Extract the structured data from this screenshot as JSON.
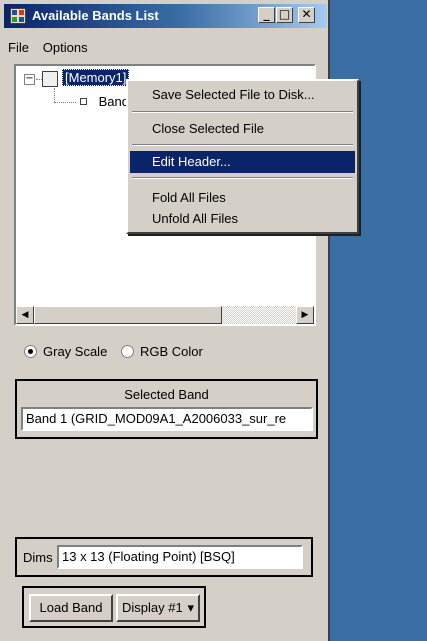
{
  "window": {
    "title": "Available Bands List",
    "controls": {
      "minimize": "_",
      "maximize": "□",
      "close": "✕"
    }
  },
  "menubar": {
    "file": "File",
    "options": "Options"
  },
  "tree": {
    "root_label": "[Memory1]",
    "root_expand": "−",
    "child_label": "Band 1"
  },
  "context_menu": {
    "items": [
      "Save Selected File to Disk...",
      "Close Selected File",
      "Edit Header...",
      "Fold All Files",
      "Unfold All Files"
    ],
    "active_index": 2
  },
  "radio": {
    "gray": "Gray Scale",
    "rgb": "RGB Color",
    "selected": "Gray Scale"
  },
  "selected_band": {
    "title": "Selected Band",
    "value": "Band 1 (GRID_MOD09A1_A2006033_sur_re"
  },
  "dims": {
    "label": "Dims",
    "value": "13 x 13 (Floating Point) [BSQ]"
  },
  "buttons": {
    "load_band": "Load Band",
    "display": "Display #1"
  },
  "colors": {
    "desktop": "#3a6ea5",
    "titlebar": "#0a246a",
    "highlight": "#0a246a",
    "face": "#d4d0c8"
  }
}
